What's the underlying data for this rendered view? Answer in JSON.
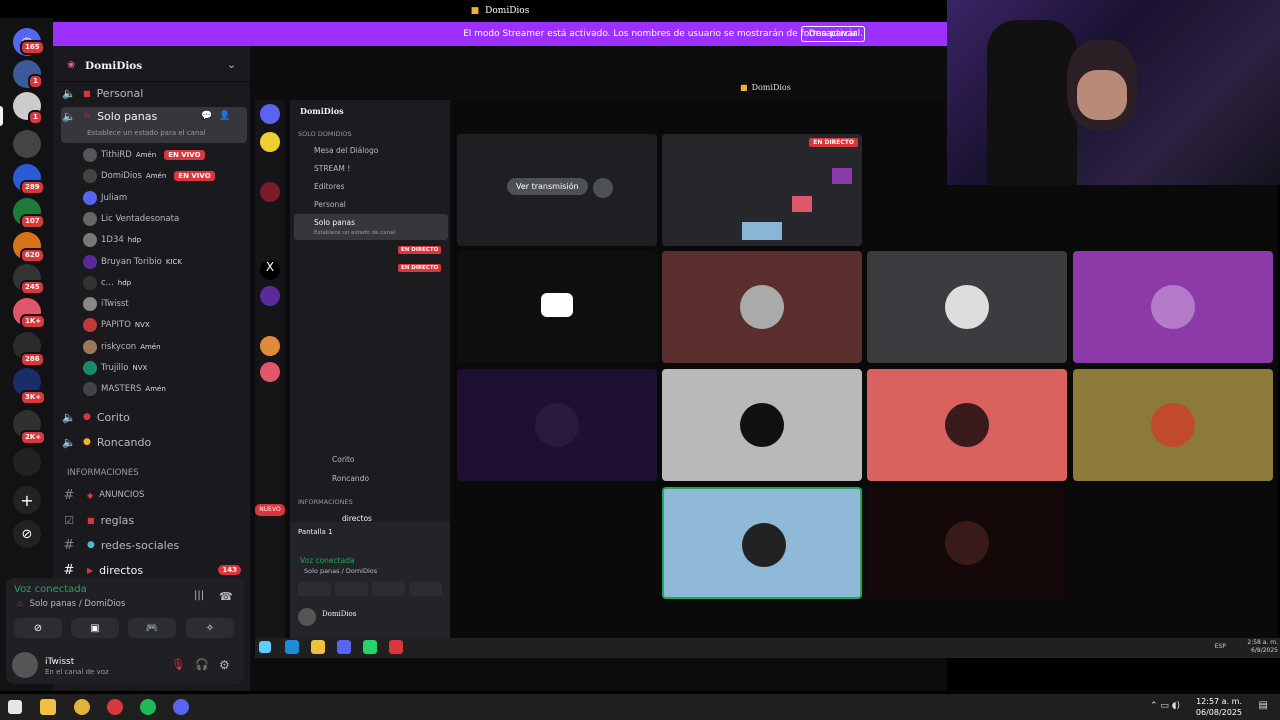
{
  "window": {
    "title": "DomiDios"
  },
  "banner": {
    "text": "El modo Streamer está activado. Los nombres de usuario se mostrarán de forma parcial.",
    "button": "Desactivar"
  },
  "server_rail": {
    "badges": [
      "165",
      "1",
      "1",
      "289",
      "107",
      "620",
      "245",
      "1K+",
      "286",
      "3K+",
      "2K+"
    ],
    "icons": [
      "discord-home-icon",
      "add-server-icon",
      "discover-icon"
    ]
  },
  "server": {
    "name": "DomiDios"
  },
  "channels": {
    "personal": "Personal",
    "solo_panas": "Solo panas",
    "solo_panas_status": "Establece un estado para el canal",
    "corito": "Corito",
    "roncando": "Roncando",
    "category": "INFORMACIONES",
    "text": [
      {
        "name": "ANUNCIOS"
      },
      {
        "name": "reglas"
      },
      {
        "name": "redes-sociales"
      },
      {
        "name": "directos",
        "badge": "143"
      }
    ]
  },
  "voice_users": [
    {
      "name": "TithiRD",
      "tag": "Amén",
      "live": "EN VIVO"
    },
    {
      "name": "DomiDios",
      "tag": "Amén",
      "live": "EN VIVO"
    },
    {
      "name": "Juliam",
      "tag": "",
      "live": ""
    },
    {
      "name": "Lic Ventadesonata",
      "tag": "",
      "live": ""
    },
    {
      "name": "1D34",
      "tag": "hdp",
      "live": ""
    },
    {
      "name": "Bruyan Toribio",
      "tag": "KICK",
      "live": ""
    },
    {
      "name": "c...",
      "tag": "hdp",
      "live": ""
    },
    {
      "name": "iTwisst",
      "tag": "",
      "live": ""
    },
    {
      "name": "PAPITO",
      "tag": "NVX",
      "live": ""
    },
    {
      "name": "riskycon",
      "tag": "Amén",
      "live": ""
    },
    {
      "name": "Trujillo",
      "tag": "NVX",
      "live": ""
    },
    {
      "name": "MASTERS",
      "tag": "Amén",
      "live": ""
    }
  ],
  "voice_panel": {
    "status": "Voz conectada",
    "channel": "Solo panas / DomiDios",
    "username": "iTwisst",
    "substatus": "En el canal de voz"
  },
  "inner": {
    "server": "DomiDios",
    "category": "SOLO DOMIDIOS",
    "channels": [
      "Mesa del Diálogo",
      "STREAM !",
      "Editores",
      "Personal",
      "Solo panas"
    ],
    "status": "Establece un estado de canal",
    "live": "EN DIRECTO",
    "corito": "Corito",
    "roncando": "Roncando",
    "info": "INFORMACIONES",
    "directos": "directos",
    "nuevo": "NUEVO",
    "pantalla": "Pantalla 1",
    "voice": "Voz conectada",
    "voice_channel": "Solo panas / DomiDios",
    "user": "DomiDios",
    "watch_button": "Ver transmisión",
    "live_tile": "EN DIRECTO",
    "clock_time": "2:58 a. m.",
    "clock_date": "6/8/2025",
    "lang": "ESP"
  },
  "taskbar": {
    "time": "12:57 a. m.",
    "date": "06/08/2025"
  },
  "colors": {
    "accent": "#9b30ff",
    "live": "#da373c",
    "voice": "#23a55a"
  }
}
